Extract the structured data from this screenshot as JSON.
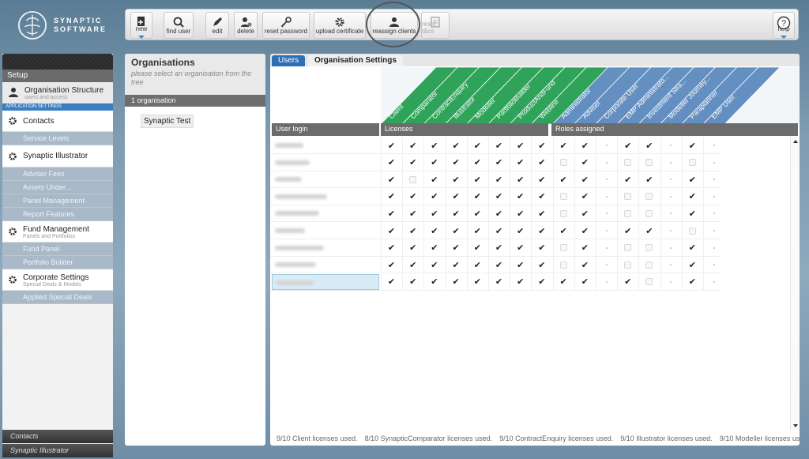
{
  "brand": {
    "line1": "SYNAPTIC",
    "line2": "SOFTWARE"
  },
  "toolbar": {
    "buttons": [
      {
        "label": "new",
        "icon": "new-document-icon"
      },
      {
        "label": "find user",
        "icon": "search-icon"
      },
      {
        "label": "edit",
        "icon": "pencil-icon"
      },
      {
        "label": "delete",
        "icon": "user-delete-icon"
      },
      {
        "label": "reset password",
        "icon": "key-icon"
      },
      {
        "label": "upload certificate",
        "icon": "gear-icon"
      },
      {
        "label": "reassign clients",
        "icon": "user-icon"
      },
      {
        "label": "reset t&cs",
        "icon": "document-icon",
        "disabled": true
      },
      {
        "label": "help",
        "icon": "help-icon"
      }
    ]
  },
  "sidebar": {
    "setup_label": "Setup",
    "app_settings_label": "APPLICATION SETTINGS",
    "sections": [
      {
        "label": "Organisation Structure",
        "sub": "users and access",
        "icon": "user-icon",
        "items": []
      },
      {
        "label": "Contacts",
        "sub": "",
        "icon": "gear-icon",
        "items": [
          "Service Levels"
        ]
      },
      {
        "label": "Synaptic Illustrator",
        "sub": "",
        "icon": "gear-icon",
        "items": [
          "Adviser Fees",
          "Assets Under...",
          "Panel Management",
          "Report Features"
        ]
      },
      {
        "label": "Fund Management",
        "sub": "Panels and Portfolios",
        "icon": "gear-icon",
        "items": [
          "Fund Panel",
          "Portfolio Builder"
        ]
      },
      {
        "label": "Corporate Settings",
        "sub": "Special Deals & Models",
        "icon": "gear-icon",
        "items": [
          "Applied Special Deals"
        ]
      }
    ],
    "bottom": [
      "Contacts",
      "Synaptic Illustrator"
    ]
  },
  "organisations": {
    "title": "Organisations",
    "hint": "please select an organisation from the tree",
    "count": "1 organisation",
    "items": [
      "Synaptic Test"
    ]
  },
  "main": {
    "tabs": [
      "Users",
      "Organisation Settings"
    ],
    "license_columns": [
      "Client",
      "Comparator",
      "ContractEnquiry",
      "Illustrator",
      "Modeller",
      "PortfolioBuilder",
      "ProductAndFund",
      "Webline"
    ],
    "role_columns": [
      "Administrator",
      "Adviser",
      "Corporate User",
      "EMP Administrato...",
      "Investment Stra...",
      "Modeller Journey...",
      "Paraplanner",
      "EMP User"
    ],
    "col_user_login": "User login",
    "col_licenses": "Licenses",
    "col_roles": "Roles assigned",
    "rows": [
      {
        "selected": false,
        "lic": [
          1,
          1,
          1,
          1,
          1,
          1,
          1,
          1
        ],
        "roles": [
          "c",
          "c",
          "d",
          "c",
          "c",
          "d",
          "c",
          "d"
        ]
      },
      {
        "selected": false,
        "lic": [
          1,
          1,
          1,
          1,
          1,
          1,
          1,
          1
        ],
        "roles": [
          "o",
          "c",
          "d",
          "o",
          "o",
          "d",
          "o",
          "d"
        ]
      },
      {
        "selected": false,
        "lic": [
          1,
          0,
          1,
          1,
          1,
          1,
          1,
          1
        ],
        "roles": [
          "c",
          "c",
          "d",
          "c",
          "c",
          "d",
          "c",
          "d"
        ]
      },
      {
        "selected": false,
        "lic": [
          1,
          1,
          1,
          1,
          1,
          1,
          1,
          1
        ],
        "roles": [
          "o",
          "c",
          "d",
          "o",
          "o",
          "d",
          "c",
          "d"
        ]
      },
      {
        "selected": false,
        "lic": [
          1,
          1,
          1,
          1,
          1,
          1,
          1,
          1
        ],
        "roles": [
          "o",
          "c",
          "d",
          "o",
          "o",
          "d",
          "c",
          "d"
        ]
      },
      {
        "selected": false,
        "lic": [
          1,
          1,
          1,
          1,
          1,
          1,
          1,
          1
        ],
        "roles": [
          "c",
          "c",
          "d",
          "c",
          "c",
          "d",
          "o",
          "d"
        ]
      },
      {
        "selected": false,
        "lic": [
          1,
          1,
          1,
          1,
          1,
          1,
          1,
          1
        ],
        "roles": [
          "o",
          "c",
          "d",
          "o",
          "o",
          "d",
          "c",
          "d"
        ]
      },
      {
        "selected": false,
        "lic": [
          1,
          1,
          1,
          1,
          1,
          1,
          1,
          1
        ],
        "roles": [
          "o",
          "c",
          "d",
          "o",
          "o",
          "d",
          "c",
          "d"
        ]
      },
      {
        "selected": true,
        "lic": [
          1,
          1,
          1,
          1,
          1,
          1,
          1,
          1
        ],
        "roles": [
          "c",
          "c",
          "d",
          "c",
          "o",
          "d",
          "c",
          "d"
        ]
      }
    ],
    "footer": [
      "9/10 Client licenses used.",
      "8/10 SynapticComparator licenses used.",
      "9/10 ContractEnquiry licenses used.",
      "9/10 Illustrator licenses used.",
      "9/10 Modeller licenses us"
    ]
  },
  "colors": {
    "license_green": "#2fa35a",
    "roles_blue": "#4a7db8",
    "tab_blue": "#2f6fb3"
  }
}
